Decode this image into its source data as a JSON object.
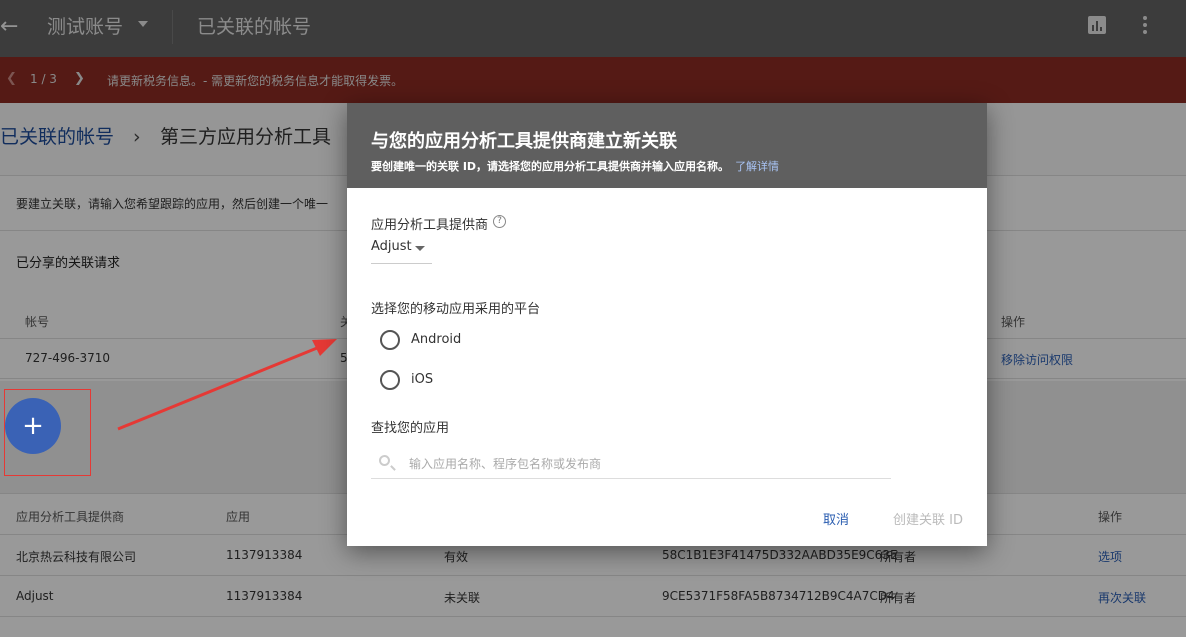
{
  "topbar": {
    "back_icon": "arrow-left-icon",
    "account": "测试账号",
    "page_title": "已关联的帐号",
    "icons": [
      "bar-chart-icon",
      "more-vert-icon"
    ]
  },
  "alert": {
    "counter": "1 / 3",
    "message": "请更新税务信息。- 需更新您的税务信息才能取得发票。",
    "color": "#8a2b22"
  },
  "breadcrumb": {
    "first": "已关联的帐号",
    "separator": "›",
    "second": "第三方应用分析工具"
  },
  "intro": {
    "text": "要建立关联，请输入您希望跟踪的应用，然后创建一个唯一"
  },
  "shared": {
    "heading": "已分享的关联请求",
    "columns": {
      "account": "帐号",
      "col2": "关",
      "actions": "操作"
    },
    "row": {
      "account": "727-496-3710",
      "col2": "5",
      "action": "移除访问权限"
    }
  },
  "fab": {
    "label": "+"
  },
  "links_table": {
    "columns": {
      "provider": "应用分析工具提供商",
      "app": "应用",
      "actions": "操作"
    },
    "rows": [
      {
        "provider": "北京热云科技有限公司",
        "app": "1137913384",
        "status": "有效",
        "link_id": "58C1B1E3F41475D332AABD35E9C63E",
        "role": "所有者",
        "action": "选项"
      },
      {
        "provider": "Adjust",
        "app": "1137913384",
        "status": "未关联",
        "link_id": "9CE5371F58FA5B8734712B9C4A7CD4",
        "role": "所有者",
        "action": "再次关联"
      }
    ]
  },
  "dialog": {
    "title": "与您的应用分析工具提供商建立新关联",
    "subtitle": "要创建唯一的关联 ID，请选择您的应用分析工具提供商并输入应用名称。",
    "learn_more": "了解详情",
    "provider_label": "应用分析工具提供商",
    "provider_value": "Adjust",
    "platform_label": "选择您的移动应用采用的平台",
    "platforms": [
      "Android",
      "iOS"
    ],
    "find_label": "查找您的应用",
    "search_placeholder": "输入应用名称、程序包名称或发布商",
    "cancel": "取消",
    "create": "创建关联 ID"
  }
}
